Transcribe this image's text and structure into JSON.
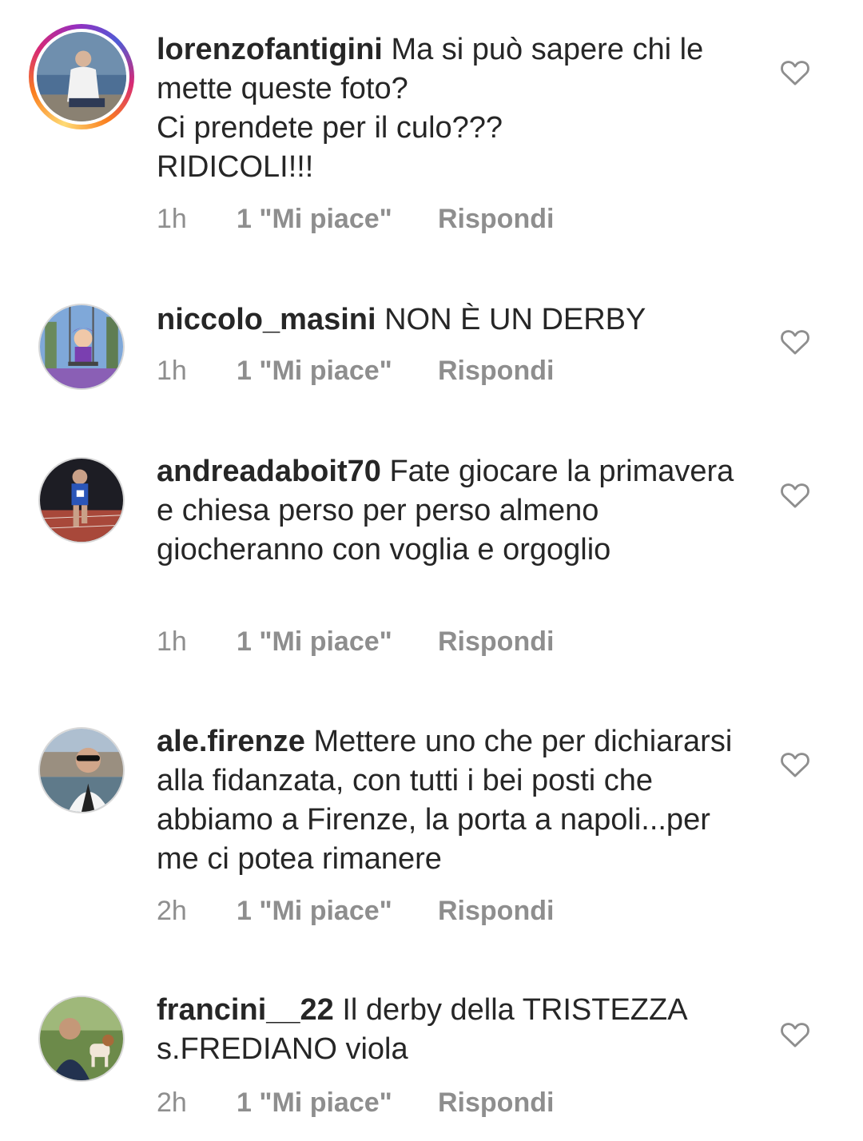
{
  "comments": [
    {
      "username": "lorenzofantigini",
      "text": "Ma si può sapere chi le mette queste foto?\nCi prendete per il culo???\nRIDICOLI!!!",
      "time": "1h",
      "likes": "1 \"Mi piace\"",
      "reply": "Rispondi"
    },
    {
      "username": "niccolo_masini",
      "text": "NON È UN DERBY",
      "time": "1h",
      "likes": "1 \"Mi piace\"",
      "reply": "Rispondi"
    },
    {
      "username": "andreadaboit70",
      "text": "Fate giocare la primavera e chiesa perso per perso almeno giocheranno con voglia e orgoglio",
      "time": "1h",
      "likes": "1 \"Mi piace\"",
      "reply": "Rispondi"
    },
    {
      "username": "ale.firenze",
      "text": "Mettere uno che per dichiararsi alla fidanzata, con tutti i bei posti che abbiamo a Firenze, la porta a napoli...per me ci potea rimanere",
      "time": "2h",
      "likes": "1 \"Mi piace\"",
      "reply": "Rispondi"
    },
    {
      "username": "francini__22",
      "text": "Il derby della TRISTEZZA s.FREDIANO viola",
      "time": "2h",
      "likes": "1 \"Mi piace\"",
      "reply": "Rispondi"
    }
  ],
  "icons": {
    "like": "heart-outline-icon",
    "avatar": "user-avatar"
  },
  "colors": {
    "text": "#262626",
    "meta": "#8e8e8e",
    "story_ring": "#d62976"
  }
}
